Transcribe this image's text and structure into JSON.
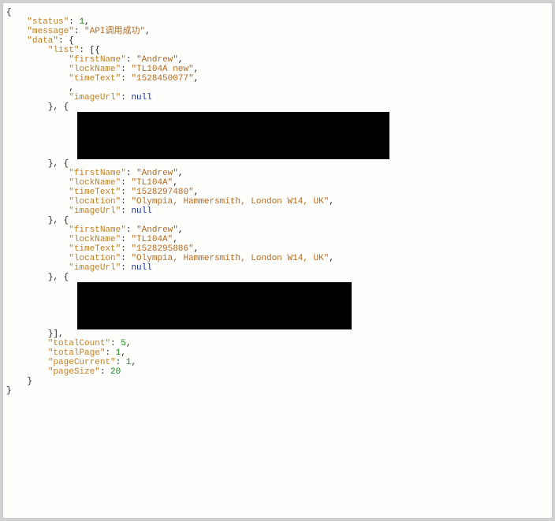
{
  "root": {
    "status_key": "\"status\"",
    "status_val": "1",
    "message_key": "\"message\"",
    "message_val": "\"API调用成功\"",
    "data_key": "\"data\"",
    "list_key": "\"list\"",
    "totalCount_key": "\"totalCount\"",
    "totalCount_val": "5",
    "totalPage_key": "\"totalPage\"",
    "totalPage_val": "1",
    "pageCurrent_key": "\"pageCurrent\"",
    "pageCurrent_val": "1",
    "pageSize_key": "\"pageSize\"",
    "pageSize_val": "20"
  },
  "items": {
    "0": {
      "firstName_key": "\"firstName\"",
      "firstName_val": "\"Andrew\"",
      "lockName_key": "\"lockName\"",
      "lockName_val": "\"TL104A new\"",
      "timeText_key": "\"timeText\"",
      "timeText_val": "\"1528450077\"",
      "imageUrl_key": "\"imageUrl\"",
      "imageUrl_val": "null"
    },
    "2": {
      "firstName_key": "\"firstName\"",
      "firstName_val": "\"Andrew\"",
      "lockName_key": "\"lockName\"",
      "lockName_val": "\"TL104A\"",
      "timeText_key": "\"timeText\"",
      "timeText_val": "\"1528297480\"",
      "location_key": "\"location\"",
      "location_val": "\"Olympia, Hammersmith, London W14, UK\"",
      "imageUrl_key": "\"imageUrl\"",
      "imageUrl_val": "null"
    },
    "3": {
      "firstName_key": "\"firstName\"",
      "firstName_val": "\"Andrew\"",
      "lockName_key": "\"lockName\"",
      "lockName_val": "\"TL104A\"",
      "timeText_key": "\"timeText\"",
      "timeText_val": "\"1528295886\"",
      "location_key": "\"location\"",
      "location_val": "\"Olympia, Hammersmith, London W14, UK\"",
      "imageUrl_key": "\"imageUrl\"",
      "imageUrl_val": "null"
    }
  }
}
